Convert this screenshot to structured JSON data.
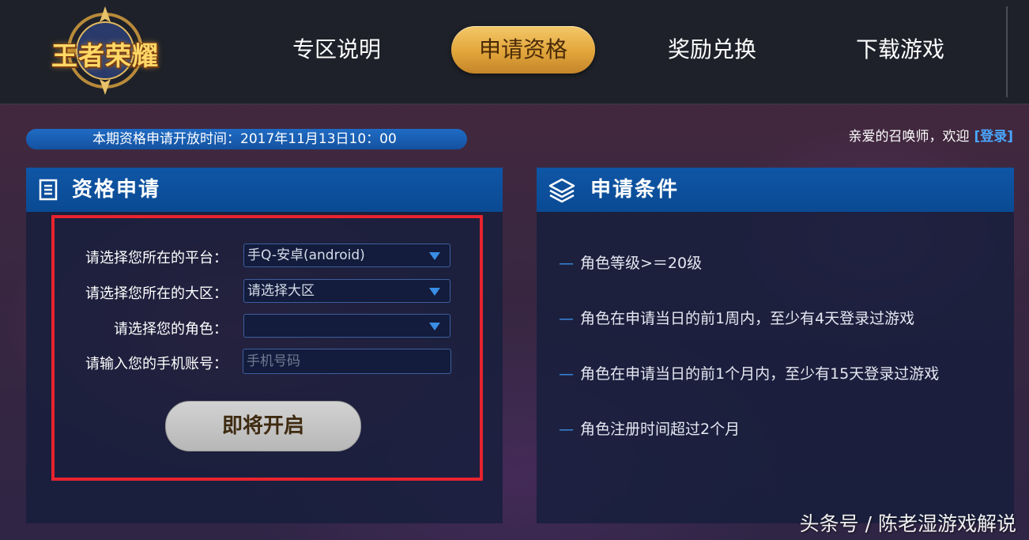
{
  "header": {
    "logo_text": "王者荣耀",
    "nav": [
      {
        "label": "专区说明"
      },
      {
        "label": "申请资格"
      },
      {
        "label": "奖励兑换"
      },
      {
        "label": "下载游戏"
      }
    ],
    "active_nav": "申请资格"
  },
  "timebar": {
    "label": "本期资格申请开放时间：",
    "value": "2017年11月13日10：00"
  },
  "welcome": {
    "text": "亲爱的召唤师，欢迎",
    "login": "[登录]"
  },
  "apply_panel": {
    "title": "资格申请",
    "fields": {
      "platform": {
        "label": "请选择您所在的平台：",
        "value": "手Q-安卓(android)"
      },
      "region": {
        "label": "请选择您所在的大区：",
        "value": "请选择大区"
      },
      "role": {
        "label": "请选择您的角色：",
        "value": ""
      },
      "phone": {
        "label": "请输入您的手机账号：",
        "placeholder": "手机号码"
      }
    },
    "submit_label": "即将开启"
  },
  "conditions_panel": {
    "title": "申请条件",
    "items": [
      "角色等级>＝20级",
      "角色在申请当日的前1周内，至少有4天登录过游戏",
      "角色在申请当日的前1个月内，至少有15天登录过游戏",
      "角色注册时间超过2个月"
    ],
    "bullet": "—"
  },
  "watermark": "头条号 / 陈老湿游戏解说",
  "colors": {
    "accent_gold": "#e2a53a",
    "panel_blue": "#0f56a6",
    "highlight_red": "#e8232f",
    "link_blue": "#4aa6ff"
  }
}
